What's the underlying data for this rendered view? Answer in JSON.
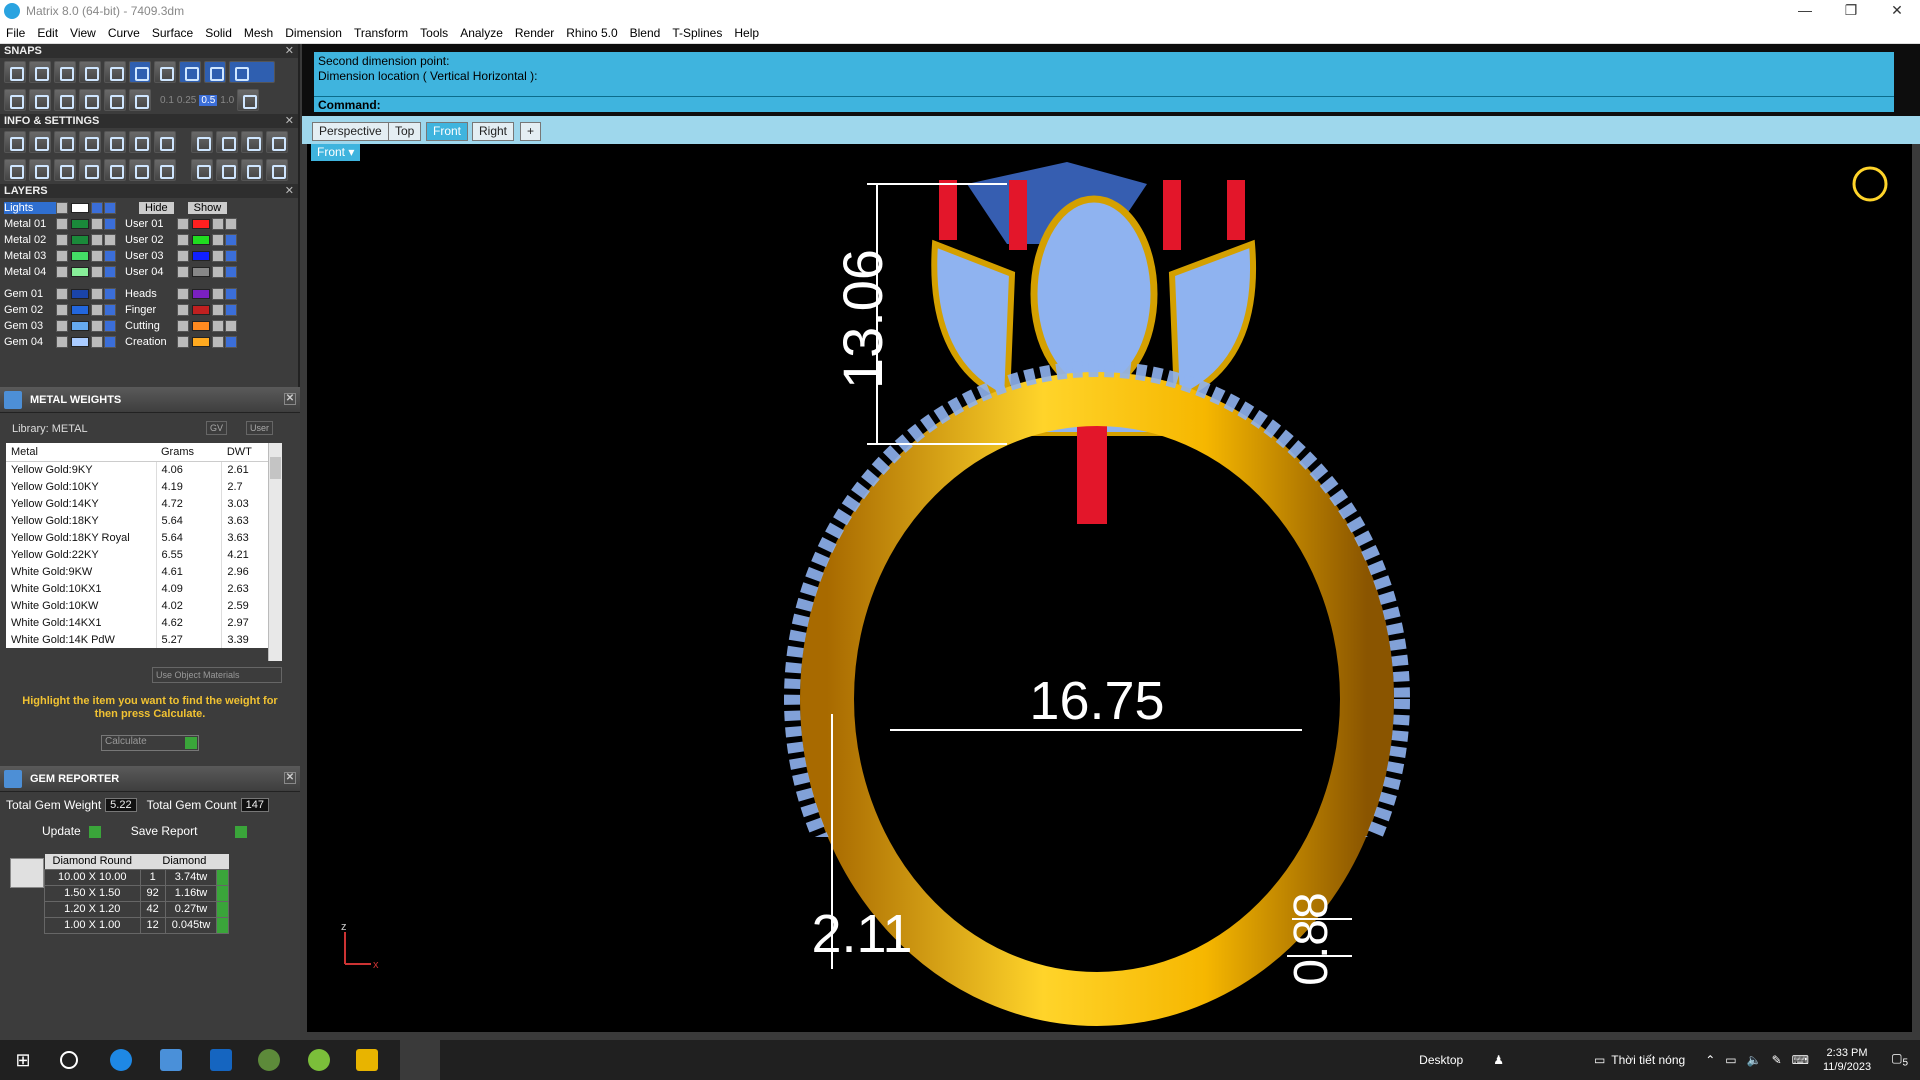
{
  "window": {
    "title": "Matrix 8.0 (64-bit) - 7409.3dm",
    "controls": [
      "—",
      "❐",
      "✕"
    ]
  },
  "menu": [
    "File",
    "Edit",
    "View",
    "Curve",
    "Surface",
    "Solid",
    "Mesh",
    "Dimension",
    "Transform",
    "Tools",
    "Analyze",
    "Render",
    "Rhino 5.0",
    "Blend",
    "T-Splines",
    "Help"
  ],
  "snaps": {
    "title": "SNAPS",
    "values": [
      "0.1",
      "0.25",
      "0.5",
      "1.0"
    ]
  },
  "info": {
    "title": "INFO & SETTINGS"
  },
  "layers": {
    "title": "LAYERS",
    "top": {
      "current": "Lights",
      "hide": "Hide",
      "show": "Show"
    },
    "left": [
      {
        "name": "Metal 01",
        "color": "#1a8a3a"
      },
      {
        "name": "Metal 02",
        "color": "#1a8a3a"
      },
      {
        "name": "Metal 03",
        "color": "#44dd66"
      },
      {
        "name": "Metal 04",
        "color": "#88ee99"
      },
      {
        "name": "Gem 01",
        "color": "#1a44aa"
      },
      {
        "name": "Gem 02",
        "color": "#2266dd"
      },
      {
        "name": "Gem 03",
        "color": "#66aaee"
      },
      {
        "name": "Gem 04",
        "color": "#aaccff"
      }
    ],
    "right": [
      {
        "name": "User 01",
        "color": "#ff2020"
      },
      {
        "name": "User 02",
        "color": "#20dd20"
      },
      {
        "name": "User 03",
        "color": "#1020ff"
      },
      {
        "name": "User 04",
        "color": "#888888"
      },
      {
        "name": "Heads",
        "color": "#7a20c0"
      },
      {
        "name": "Finger",
        "color": "#c02020"
      },
      {
        "name": "Cutting",
        "color": "#ff8a20"
      },
      {
        "name": "Creation",
        "color": "#ffaa20"
      }
    ]
  },
  "metal_weights": {
    "title": "METAL WEIGHTS",
    "library": "Library: METAL",
    "gv": "GV",
    "user": "User",
    "columns": [
      "Metal",
      "Grams",
      "DWT"
    ],
    "rows": [
      [
        "Yellow Gold:9KY",
        "4.06",
        "2.61"
      ],
      [
        "Yellow Gold:10KY",
        "4.19",
        "2.7"
      ],
      [
        "Yellow Gold:14KY",
        "4.72",
        "3.03"
      ],
      [
        "Yellow Gold:18KY",
        "5.64",
        "3.63"
      ],
      [
        "Yellow Gold:18KY Royal",
        "5.64",
        "3.63"
      ],
      [
        "Yellow Gold:22KY",
        "6.55",
        "4.21"
      ],
      [
        "White Gold:9KW",
        "4.61",
        "2.96"
      ],
      [
        "White Gold:10KX1",
        "4.09",
        "2.63"
      ],
      [
        "White Gold:10KW",
        "4.02",
        "2.59"
      ],
      [
        "White Gold:14KX1",
        "4.62",
        "2.97"
      ],
      [
        "White Gold:14K PdW",
        "5.27",
        "3.39"
      ]
    ],
    "use_object": "Use Object Materials",
    "hint": "Highlight the item you want to find the weight for then press Calculate.",
    "calculate": "Calculate"
  },
  "gem_reporter": {
    "title": "GEM REPORTER",
    "weight_label": "Total Gem Weight",
    "weight": "5.22",
    "count_label": "Total Gem Count",
    "count": "147",
    "update": "Update",
    "save": "Save Report",
    "columns": [
      "Diamond Round",
      "Diamond"
    ],
    "rows": [
      [
        "10.00 X 10.00",
        "1",
        "3.74tw"
      ],
      [
        "1.50 X 1.50",
        "92",
        "1.16tw"
      ],
      [
        "1.20 X 1.20",
        "42",
        "0.27tw"
      ],
      [
        "1.00 X 1.00",
        "12",
        "0.045tw"
      ]
    ]
  },
  "command": {
    "history": [
      "Second dimension point:",
      "Dimension location ( Vertical  Horizontal ):"
    ],
    "prompt": "Command:"
  },
  "view_tabs": [
    "Perspective",
    "Top",
    "Front",
    "Right",
    "+"
  ],
  "active_view": "Front",
  "viewport": {
    "label": "Front",
    "dims": {
      "height": "13.06",
      "inner": "16.75",
      "band_width": "2.11",
      "band_thickness": "0.88"
    },
    "axis": {
      "z": "z",
      "x": "x"
    }
  },
  "taskbar": {
    "desktop": "Desktop",
    "weather": "Thời tiết nóng",
    "time": "2:33 PM",
    "date": "11/9/2023",
    "notifications": "5"
  }
}
